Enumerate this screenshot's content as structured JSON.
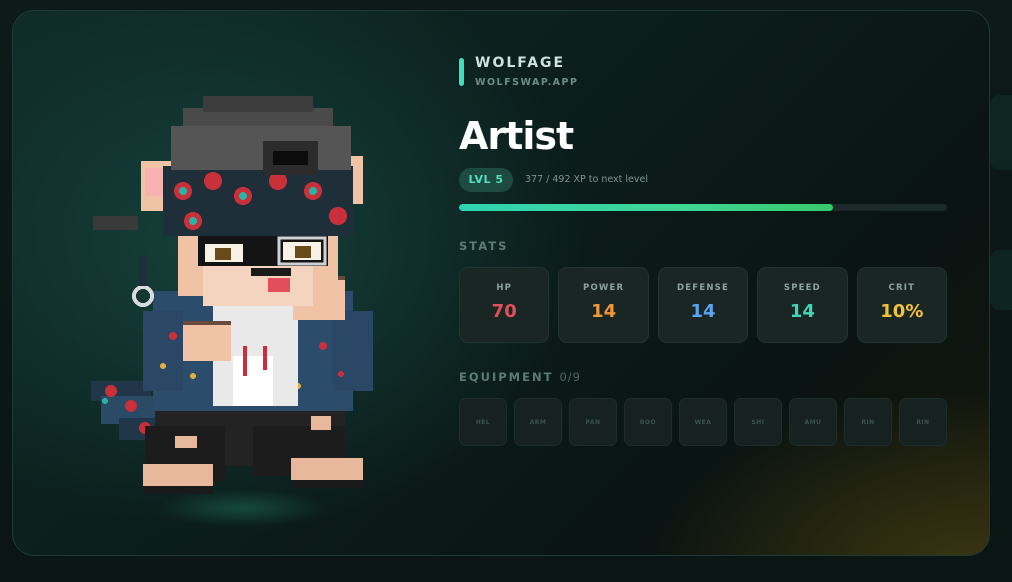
{
  "brand": {
    "title": "WOLFAGE",
    "url": "WOLFSWAP.APP"
  },
  "character": {
    "name": "Artist",
    "avatar_icon": "pixel-wolf-character"
  },
  "level": {
    "badge": "LVL 5",
    "xp_text": "377 / 492 XP to next level",
    "xp_progress": 0.766
  },
  "stats": {
    "heading": "STATS",
    "items": [
      {
        "label": "HP",
        "value": "70",
        "color": "#e0505a"
      },
      {
        "label": "POWER",
        "value": "14",
        "color": "#f0973a"
      },
      {
        "label": "DEFENSE",
        "value": "14",
        "color": "#5aa4f0"
      },
      {
        "label": "SPEED",
        "value": "14",
        "color": "#3fd6b6"
      },
      {
        "label": "CRIT",
        "value": "10%",
        "color": "#f2c23a"
      }
    ]
  },
  "equipment": {
    "heading": "EQUIPMENT",
    "count": "0/9",
    "slots": [
      "HEL",
      "ARM",
      "PAN",
      "BOO",
      "WEA",
      "SHI",
      "AMU",
      "RIN",
      "RIN"
    ]
  },
  "colors": {
    "accent": "#3fe0b8",
    "card_bg": "#0f2a27"
  }
}
